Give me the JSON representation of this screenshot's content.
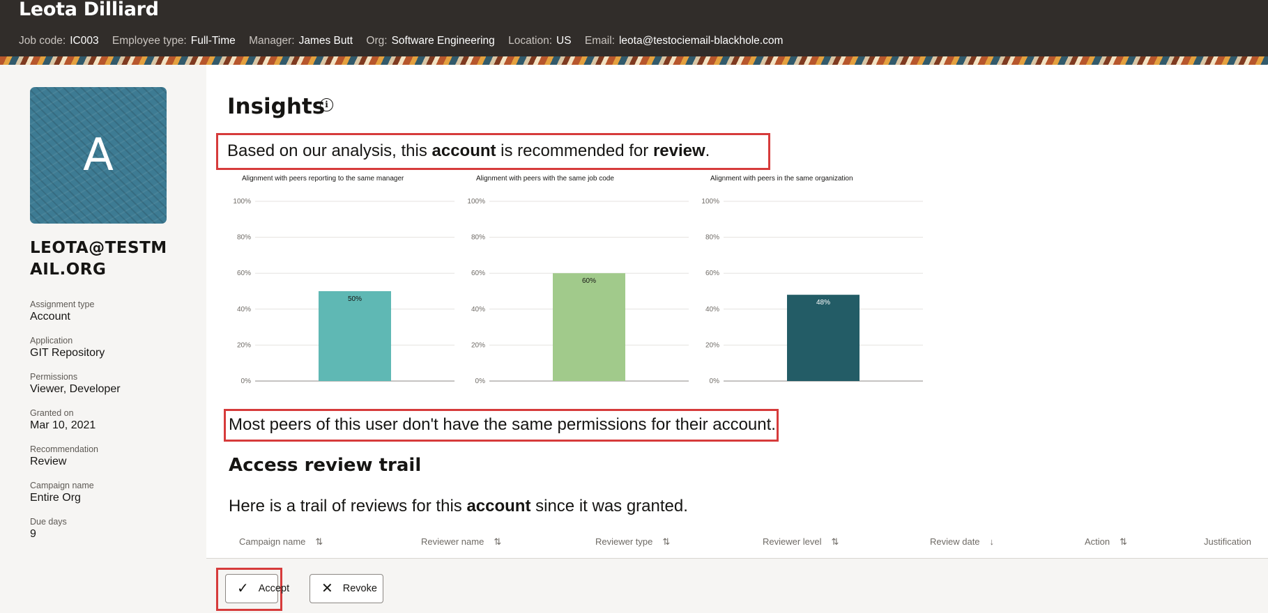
{
  "header": {
    "name": "Leota Dilliard",
    "meta": [
      {
        "label": "Job code:",
        "value": "IC003"
      },
      {
        "label": "Employee type:",
        "value": "Full-Time"
      },
      {
        "label": "Manager:",
        "value": "James Butt"
      },
      {
        "label": "Org:",
        "value": "Software Engineering"
      },
      {
        "label": "Location:",
        "value": "US"
      },
      {
        "label": "Email:",
        "value": "leota@testociemail-blackhole.com"
      }
    ]
  },
  "sidebar": {
    "avatar_letter": "A",
    "user_email": "LEOTA@TESTMAIL.ORG",
    "attributes": [
      {
        "label": "Assignment type",
        "value": "Account"
      },
      {
        "label": "Application",
        "value": "GIT Repository"
      },
      {
        "label": "Permissions",
        "value": "Viewer, Developer"
      },
      {
        "label": "Granted on",
        "value": "Mar 10, 2021"
      },
      {
        "label": "Recommendation",
        "value": "Review"
      },
      {
        "label": "Campaign name",
        "value": "Entire Org"
      },
      {
        "label": "Due days",
        "value": "9"
      }
    ]
  },
  "insights": {
    "title": "Insights",
    "info_glyph": "i",
    "recommend_pre": "Based on our analysis, this ",
    "recommend_bold1": "account",
    "recommend_mid": " is recommended for ",
    "recommend_bold2": "review",
    "recommend_post": ".",
    "peers_text": "Most peers of this user don't have the same permissions for their account."
  },
  "chart_data": [
    {
      "type": "bar",
      "title": "Alignment with peers reporting to the same manager",
      "ylim": [
        0,
        100
      ],
      "y_ticks": [
        "0%",
        "20%",
        "40%",
        "60%",
        "80%",
        "100%"
      ],
      "values": [
        50
      ],
      "value_labels": [
        "50%"
      ],
      "color": "#5fb8b4",
      "label_color": "#161513",
      "grid": true
    },
    {
      "type": "bar",
      "title": "Alignment with peers with the same job code",
      "ylim": [
        0,
        100
      ],
      "y_ticks": [
        "0%",
        "20%",
        "40%",
        "60%",
        "80%",
        "100%"
      ],
      "values": [
        60
      ],
      "value_labels": [
        "60%"
      ],
      "color": "#a1ca8b",
      "label_color": "#161513",
      "grid": true
    },
    {
      "type": "bar",
      "title": "Alignment with peers in the same organization",
      "ylim": [
        0,
        100
      ],
      "y_ticks": [
        "0%",
        "20%",
        "40%",
        "60%",
        "80%",
        "100%"
      ],
      "values": [
        48
      ],
      "value_labels": [
        "48%"
      ],
      "color": "#235c66",
      "label_color": "#ffffff",
      "grid": true
    }
  ],
  "trail": {
    "title": "Access review trail",
    "desc_pre": "Here is a trail of reviews for this ",
    "desc_bold": "account",
    "desc_post": " since it was granted.",
    "columns": [
      {
        "label": "Campaign name",
        "sort": "⇅"
      },
      {
        "label": "Reviewer name",
        "sort": "⇅"
      },
      {
        "label": "Reviewer type",
        "sort": "⇅"
      },
      {
        "label": "Reviewer level",
        "sort": "⇅"
      },
      {
        "label": "Review date",
        "sort": "↓"
      },
      {
        "label": "Action",
        "sort": "⇅"
      },
      {
        "label": "Justification",
        "sort": ""
      }
    ]
  },
  "footer": {
    "accept_label": "Accept",
    "accept_icon": "✓",
    "revoke_label": "Revoke",
    "revoke_icon": "✕"
  },
  "colors": {
    "header_bg": "#312d2a",
    "sidebar_bg": "#f6f5f3",
    "highlight_border": "#d63b3b",
    "avatar_bg": "#3d7b93"
  }
}
